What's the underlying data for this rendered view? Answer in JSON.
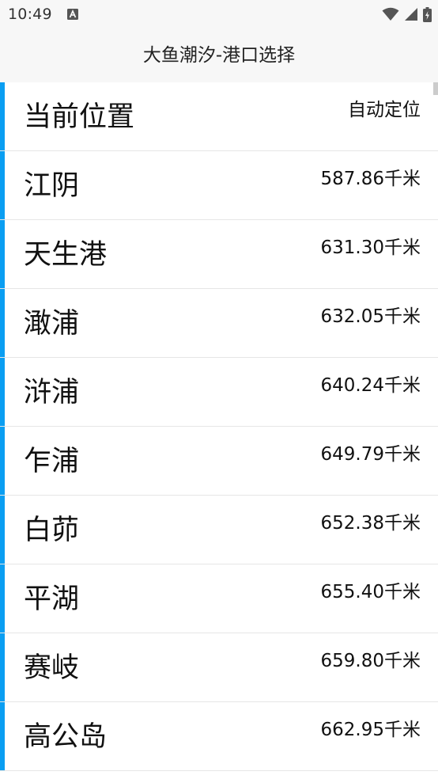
{
  "status_bar": {
    "time": "10:49",
    "icons": [
      "a-notification-icon",
      "wifi-icon",
      "cell-signal-icon",
      "battery-icon"
    ]
  },
  "header": {
    "title": "大鱼潮汐-港口选择"
  },
  "colors": {
    "accent": "#0a9ef2",
    "header_bg": "#f7f7f7",
    "divider": "#e6e6e6"
  },
  "current_location": {
    "label": "当前位置",
    "action": "自动定位"
  },
  "ports": [
    {
      "name": "江阴",
      "distance": "587.86千米"
    },
    {
      "name": "天生港",
      "distance": "631.30千米"
    },
    {
      "name": "澉浦",
      "distance": "632.05千米"
    },
    {
      "name": "浒浦",
      "distance": "640.24千米"
    },
    {
      "name": "乍浦",
      "distance": "649.79千米"
    },
    {
      "name": "白茆",
      "distance": "652.38千米"
    },
    {
      "name": "平湖",
      "distance": "655.40千米"
    },
    {
      "name": "赛岐",
      "distance": "659.80千米"
    },
    {
      "name": "高公岛",
      "distance": "662.95千米"
    }
  ]
}
